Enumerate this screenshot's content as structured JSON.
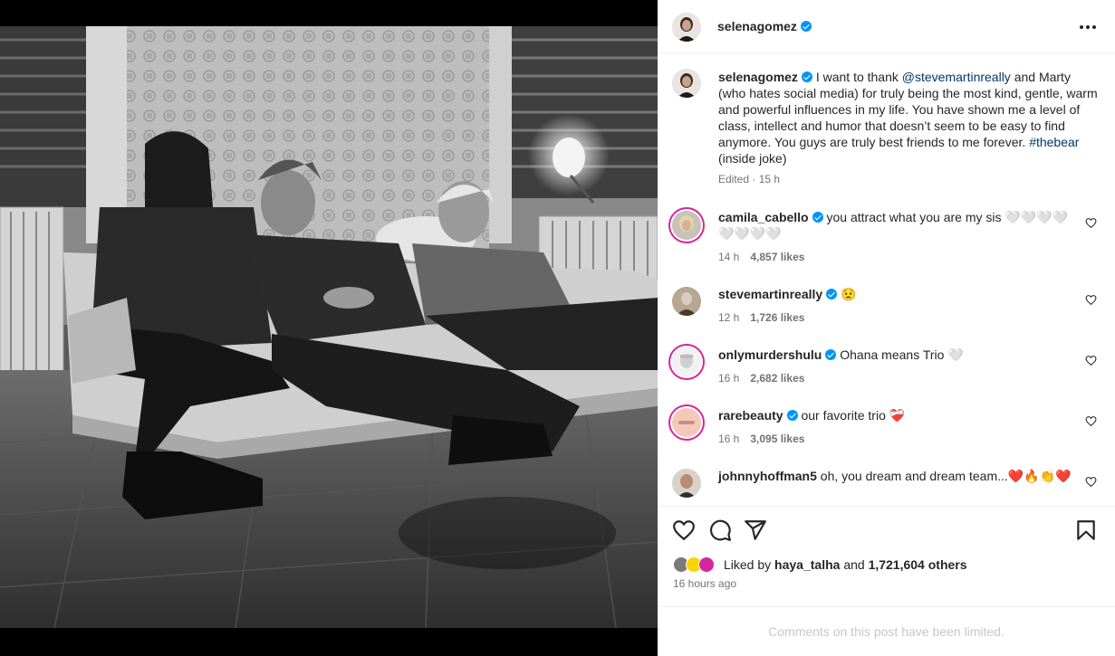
{
  "post": {
    "author": "selenagomez",
    "caption": {
      "username": "selenagomez",
      "text_before_mention": "I want to thank ",
      "mention": "@stevemartinreally",
      "text_after_mention": " and Marty (who hates social media) for truly being the most kind, gentle, warm and powerful influences in my life. You have shown me a level of class, intellect and humor that doesn’t seem to be easy to find anymore. You guys are truly best friends to me forever. ",
      "hashtag": "#thebear",
      "text_end": " (inside joke)",
      "meta": "Edited · 15 h"
    }
  },
  "comments": [
    {
      "username": "camila_cabello",
      "text": "you attract what you are my sis 🤍🤍🤍🤍🤍🤍🤍🤍",
      "time": "14 h",
      "likes": "4,857 likes"
    },
    {
      "username": "stevemartinreally",
      "text": "😟",
      "time": "12 h",
      "likes": "1,726 likes"
    },
    {
      "username": "onlymurdershulu",
      "text": "Ohana means Trio 🤍",
      "time": "16 h",
      "likes": "2,682 likes"
    },
    {
      "username": "rarebeauty",
      "text": "our favorite trio ❤️‍🩹",
      "time": "16 h",
      "likes": "3,095 likes"
    },
    {
      "username": "johnnyhoffman5",
      "text": "oh, you dream and dream team...❤️🔥👏❤️",
      "time": "",
      "likes": ""
    }
  ],
  "likes": {
    "liked_by_prefix": "Liked by",
    "liked_by_user": "haya_talha",
    "and": "and",
    "others": "1,721,604 others",
    "time": "16 hours ago"
  },
  "footer": {
    "limited": "Comments on this post have been limited."
  },
  "icons": {
    "like": "heart-icon",
    "comment": "comment-icon",
    "share": "share-icon",
    "save": "bookmark-icon",
    "more": "more-options-icon",
    "verified": "verified-badge-icon"
  },
  "colors": {
    "link": "#00376b",
    "verified": "#0095f6",
    "muted": "#737373",
    "limited": "#c7c7c7"
  }
}
